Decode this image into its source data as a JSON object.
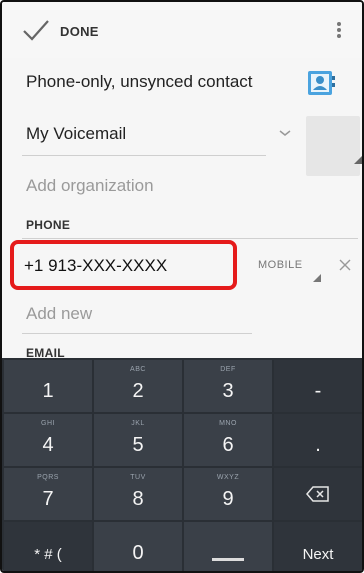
{
  "action_bar": {
    "done_label": "DONE"
  },
  "account": {
    "label": "Phone-only, unsynced contact"
  },
  "name": {
    "value": "My Voicemail"
  },
  "organization": {
    "placeholder": "Add organization"
  },
  "phone_section": {
    "header": "PHONE",
    "number": "+1 913-XXX-XXXX",
    "type": "MOBILE",
    "add_new": "Add new"
  },
  "email_section": {
    "header": "EMAIL"
  },
  "keyboard": {
    "keys": [
      {
        "main": "1",
        "sub": ""
      },
      {
        "main": "2",
        "sub": "ABC"
      },
      {
        "main": "3",
        "sub": "DEF"
      },
      {
        "main": "-",
        "sub": ""
      },
      {
        "main": "4",
        "sub": "GHI"
      },
      {
        "main": "5",
        "sub": "JKL"
      },
      {
        "main": "6",
        "sub": "MNO"
      },
      {
        "main": ".",
        "sub": ""
      },
      {
        "main": "7",
        "sub": "PQRS"
      },
      {
        "main": "8",
        "sub": "TUV"
      },
      {
        "main": "9",
        "sub": "WXYZ"
      },
      {
        "main": "",
        "sub": "",
        "icon": "backspace-icon"
      },
      {
        "main": "* # (",
        "sub": ""
      },
      {
        "main": "0",
        "sub": ""
      },
      {
        "main": "",
        "sub": "",
        "icon": "space-icon"
      },
      {
        "main": "Next",
        "sub": ""
      }
    ]
  },
  "colors": {
    "highlight": "#e51b1b",
    "keyboard_bg": "#2a2f35",
    "key_bg": "#3a4048"
  }
}
